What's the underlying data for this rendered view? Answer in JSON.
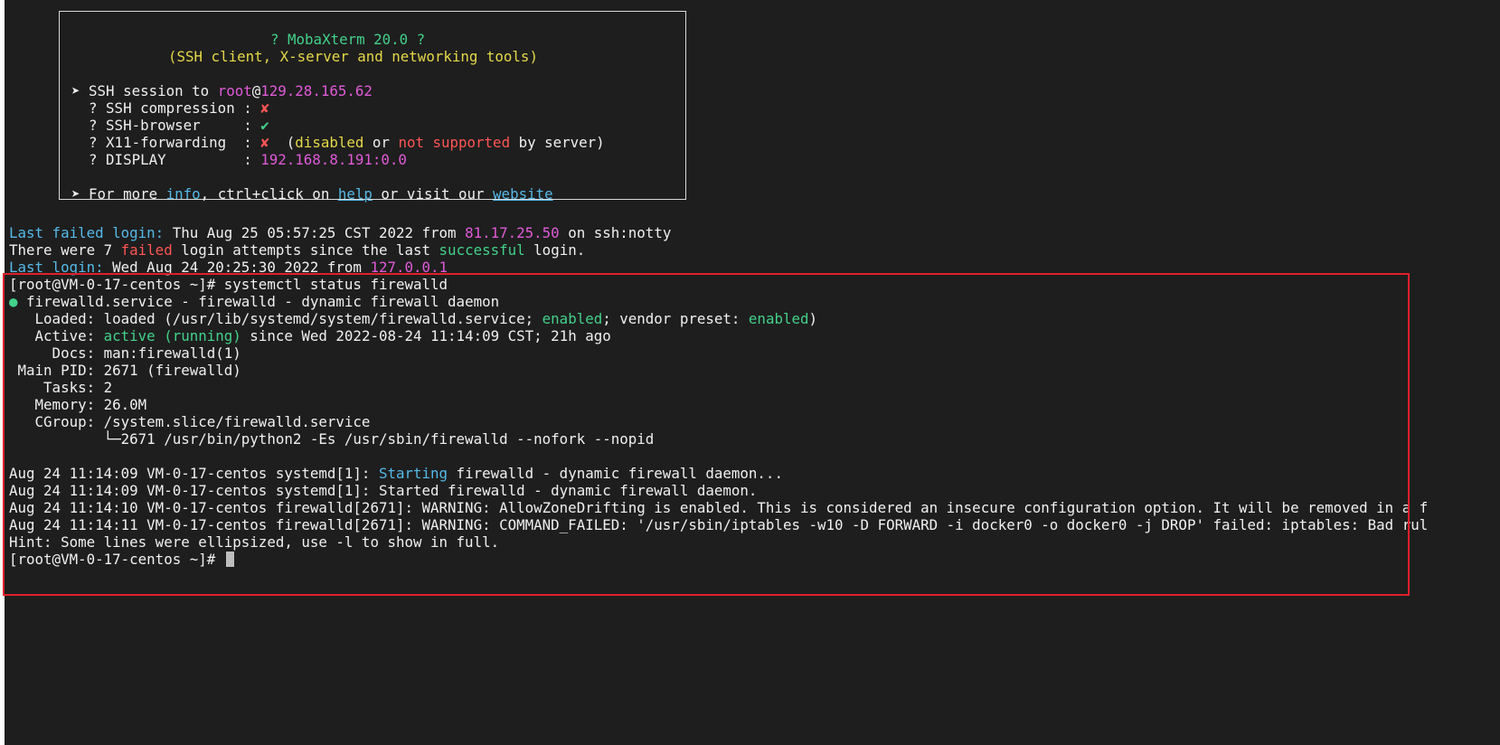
{
  "banner": {
    "title": "? MobaXterm 20.0 ?",
    "subtitle": "(SSH client, X-server and networking tools)",
    "ssh_session_prefix": "➤ SSH session to ",
    "ssh_user": "root",
    "ssh_at": "@",
    "ssh_host": "129.28.165.62",
    "compression_label": "  ? SSH compression : ",
    "compression_value": "✘",
    "browser_label": "  ? SSH-browser     : ",
    "browser_value": "✔",
    "x11_label": "  ? X11-forwarding  : ",
    "x11_value": "✘",
    "x11_note_open": "  (",
    "x11_disabled": "disabled",
    "x11_or": " or ",
    "x11_not_supported": "not supported",
    "x11_note_close": " by server)",
    "display_label": "  ? DISPLAY         : ",
    "display_value": "192.168.8.191:0.0",
    "more_prefix": "➤ For more ",
    "more_info": "info",
    "more_mid": ", ctrl+click on ",
    "more_help": "help",
    "more_or": " or visit our ",
    "more_website": "website"
  },
  "login": {
    "last_failed_label": "Last failed login:",
    "last_failed_text": " Thu Aug 25 05:57:25 CST 2022 from ",
    "last_failed_ip": "81.17.25.50",
    "last_failed_suffix": " on ssh:notty",
    "attempts_prefix": "There were 7 ",
    "attempts_failed": "failed",
    "attempts_mid": " login attempts since the last ",
    "attempts_successful": "successful",
    "attempts_suffix": " login.",
    "last_login_label": "Last login:",
    "last_login_text": " Wed Aug 24 20:25:30 2022 from ",
    "last_login_ip": "127.0.0.1"
  },
  "output": {
    "prompt_command": "[root@VM-0-17-centos ~]# systemctl status firewalld",
    "dot": "●",
    "service_line": " firewalld.service - firewalld - dynamic firewall daemon",
    "loaded_prefix": "   Loaded: loaded (/usr/lib/systemd/system/firewalld.service; ",
    "loaded_enabled": "enabled",
    "loaded_mid": "; vendor preset: ",
    "loaded_preset": "enabled",
    "loaded_suffix": ")",
    "active_prefix": "   Active: ",
    "active_state": "active (running)",
    "active_suffix": " since Wed 2022-08-24 11:14:09 CST; 21h ago",
    "docs": "     Docs: man:firewalld(1)",
    "main_pid": " Main PID: 2671 (firewalld)",
    "tasks": "    Tasks: 2",
    "memory": "   Memory: 26.0M",
    "cgroup": "   CGroup: /system.slice/firewalld.service",
    "cgroup_child": "           └─2671 /usr/bin/python2 -Es /usr/sbin/firewalld --nofork --nopid",
    "log1_prefix": "Aug 24 11:14:09 VM-0-17-centos systemd[1]: ",
    "log1_starting": "Starting",
    "log1_suffix": " firewalld - dynamic firewall daemon...",
    "log2": "Aug 24 11:14:09 VM-0-17-centos systemd[1]: Started firewalld - dynamic firewall daemon.",
    "log3": "Aug 24 11:14:10 VM-0-17-centos firewalld[2671]: WARNING: AllowZoneDrifting is enabled. This is considered an insecure configuration option. It will be removed in a f",
    "log4": "Aug 24 11:14:11 VM-0-17-centos firewalld[2671]: WARNING: COMMAND_FAILED: '/usr/sbin/iptables -w10 -D FORWARD -i docker0 -o docker0 -j DROP' failed: iptables: Bad rul",
    "hint": "Hint: Some lines were ellipsized, use -l to show in full.",
    "final_prompt": "[root@VM-0-17-centos ~]# "
  },
  "colors": {
    "background": "#1e1e1e",
    "green": "#43d18a",
    "yellow": "#e5d84a",
    "magenta": "#e05ad8",
    "red": "#ff5555",
    "cyan": "#55b9e8",
    "highlight_border": "#e0202c"
  }
}
